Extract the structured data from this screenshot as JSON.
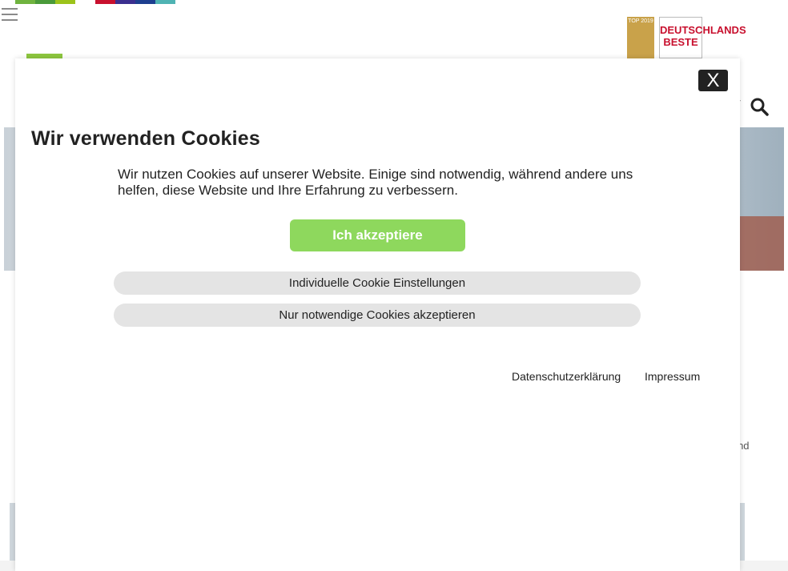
{
  "cookie_dialog": {
    "close_label": "X",
    "title": "Wir verwenden Cookies",
    "description": "Wir nutzen Cookies auf unserer Website. Einige sind notwendig, während andere uns helfen, diese Website und Ihre Erfahrung zu verbessern.",
    "accept_label": "Ich akzeptiere",
    "individual_settings_label": "Individuelle Cookie Einstellungen",
    "necessary_only_label": "Nur notwendige Cookies akzeptieren",
    "footer_links": {
      "privacy": "Datenschutzerklärung",
      "imprint": "Impressum"
    },
    "colors": {
      "accept_button": "#8ed85d",
      "pill_button": "#e4e4e4",
      "close_button": "#222222"
    }
  },
  "background_page": {
    "badge_top_text": "TOP 2019",
    "badge_test_text": "DEUTSCHLANDS BESTE",
    "partial_text": "g und",
    "icons": [
      "menu-icon",
      "search-icon",
      "chevron-down-icon"
    ],
    "strip_colors": [
      "#6fb33f",
      "#4a9a3a",
      "#9cc31b",
      "#ffffff",
      "#c8102e",
      "#3b2f8f",
      "#1d3f8f",
      "#4fb3b3"
    ]
  }
}
